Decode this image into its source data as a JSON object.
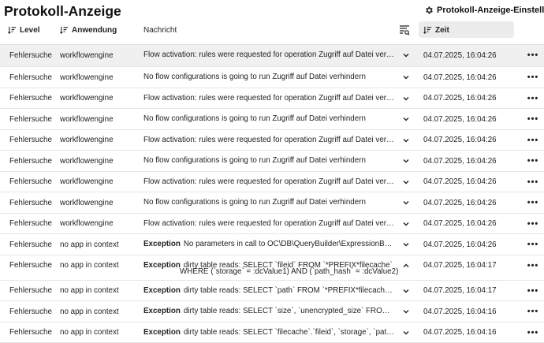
{
  "page": {
    "title": "Protokoll-Anzeige",
    "settings_label": "Protokoll-Anzeige-Einstellungen"
  },
  "columns": {
    "level": "Level",
    "app": "Anwendung",
    "message": "Nachricht",
    "time": "Zeit"
  },
  "rows": [
    {
      "level": "Fehlersuche",
      "app": "workflowengine",
      "exception": "",
      "message": "Flow activation: rules were requested for operation Zugriff auf Datei verhindern",
      "message2": "",
      "time": "04.07.2025, 16:04:26",
      "expanded": false,
      "selected": true
    },
    {
      "level": "Fehlersuche",
      "app": "workflowengine",
      "exception": "",
      "message": "No flow configurations is going to run Zugriff auf Datei verhindern",
      "message2": "",
      "time": "04.07.2025, 16:04:26",
      "expanded": false,
      "selected": false
    },
    {
      "level": "Fehlersuche",
      "app": "workflowengine",
      "exception": "",
      "message": "Flow activation: rules were requested for operation Zugriff auf Datei verhindern",
      "message2": "",
      "time": "04.07.2025, 16:04:26",
      "expanded": false,
      "selected": false
    },
    {
      "level": "Fehlersuche",
      "app": "workflowengine",
      "exception": "",
      "message": "No flow configurations is going to run Zugriff auf Datei verhindern",
      "message2": "",
      "time": "04.07.2025, 16:04:26",
      "expanded": false,
      "selected": false
    },
    {
      "level": "Fehlersuche",
      "app": "workflowengine",
      "exception": "",
      "message": "Flow activation: rules were requested for operation Zugriff auf Datei verhindern",
      "message2": "",
      "time": "04.07.2025, 16:04:26",
      "expanded": false,
      "selected": false
    },
    {
      "level": "Fehlersuche",
      "app": "workflowengine",
      "exception": "",
      "message": "No flow configurations is going to run Zugriff auf Datei verhindern",
      "message2": "",
      "time": "04.07.2025, 16:04:26",
      "expanded": false,
      "selected": false
    },
    {
      "level": "Fehlersuche",
      "app": "workflowengine",
      "exception": "",
      "message": "Flow activation: rules were requested for operation Zugriff auf Datei verhindern",
      "message2": "",
      "time": "04.07.2025, 16:04:26",
      "expanded": false,
      "selected": false
    },
    {
      "level": "Fehlersuche",
      "app": "workflowengine",
      "exception": "",
      "message": "No flow configurations is going to run Zugriff auf Datei verhindern",
      "message2": "",
      "time": "04.07.2025, 16:04:26",
      "expanded": false,
      "selected": false
    },
    {
      "level": "Fehlersuche",
      "app": "workflowengine",
      "exception": "",
      "message": "Flow activation: rules were requested for operation Zugriff auf Datei verhindern",
      "message2": "",
      "time": "04.07.2025, 16:04:26",
      "expanded": false,
      "selected": false
    },
    {
      "level": "Fehlersuche",
      "app": "no app in context",
      "exception": "Exception",
      "message": "No parameters in call to OC\\DB\\QueryBuilder\\ExpressionBuilder",
      "message2": "",
      "time": "04.07.2025, 16:04:26",
      "expanded": false,
      "selected": false
    },
    {
      "level": "Fehlersuche",
      "app": "no app in context",
      "exception": "Exception",
      "message": "dirty table reads: SELECT `fileid` FROM `*PREFIX*filecache`",
      "message2": "WHERE (`storage` = :dcValue1) AND (`path_hash` = :dcValue2)",
      "time": "04.07.2025, 16:04:17",
      "expanded": true,
      "selected": false
    },
    {
      "level": "Fehlersuche",
      "app": "no app in context",
      "exception": "Exception",
      "message": "dirty table reads: SELECT `path` FROM `*PREFIX*filecache` WHERE",
      "message2": "",
      "time": "04.07.2025, 16:04:17",
      "expanded": false,
      "selected": false
    },
    {
      "level": "Fehlersuche",
      "app": "no app in context",
      "exception": "Exception",
      "message": "dirty table reads: SELECT `size`, `unencrypted_size` FROM `*PREFIX*filecache`",
      "message2": "",
      "time": "04.07.2025, 16:04:16",
      "expanded": false,
      "selected": false
    },
    {
      "level": "Fehlersuche",
      "app": "no app in context",
      "exception": "Exception",
      "message": "dirty table reads: SELECT `filecache`.`fileid`, `storage`, `path`, `path_hash`",
      "message2": "",
      "time": "04.07.2025, 16:04:16",
      "expanded": false,
      "selected": false
    }
  ]
}
